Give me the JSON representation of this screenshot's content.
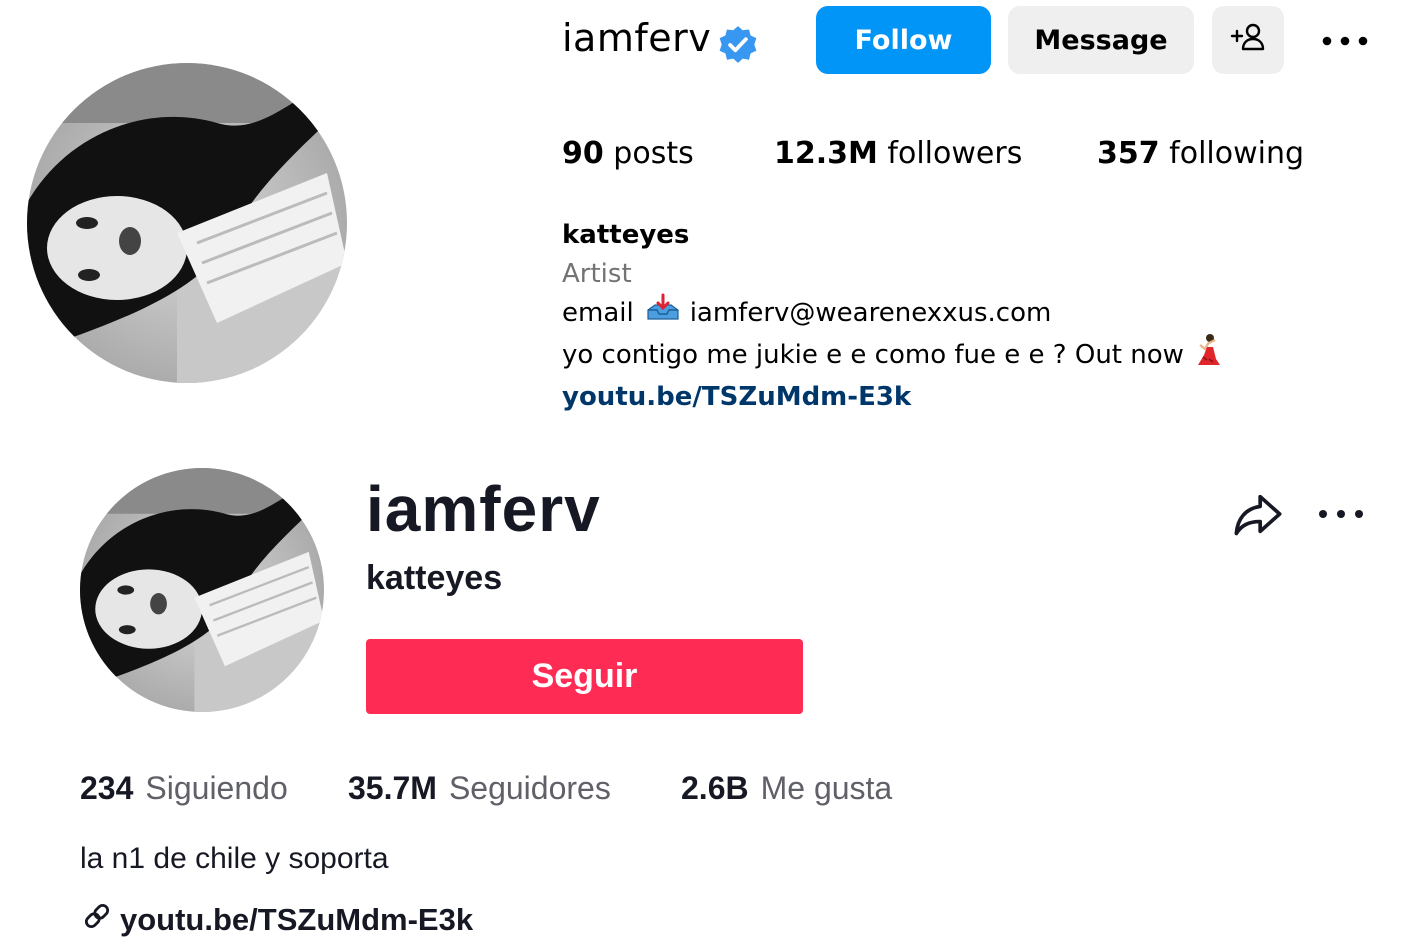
{
  "instagram": {
    "username": "iamferv",
    "verified_icon": "verified-badge-icon",
    "follow_label": "Follow",
    "message_label": "Message",
    "add_user_icon": "add-user-icon",
    "more_icon": "more-options-icon",
    "stats": [
      {
        "value": "90",
        "label": "posts"
      },
      {
        "value": "12.3M",
        "label": "followers"
      },
      {
        "value": "357",
        "label": "following"
      }
    ],
    "bio": {
      "name": "katteyes",
      "category": "Artist",
      "email_prefix": "email",
      "email_emoji": "inbox-tray-icon",
      "email": "iamferv@wearenexxus.com",
      "tagline": "yo contigo me jukie e e como fue e e ? Out now",
      "tagline_emoji": "dancer-icon",
      "link": "youtu.be/TSZuMdm-E3k"
    },
    "colors": {
      "follow": "#0095f6",
      "secondary": "#efefef",
      "link": "#00376b"
    }
  },
  "tiktok": {
    "username": "iamferv",
    "nickname": "katteyes",
    "follow_label": "Seguir",
    "share_icon": "share-icon",
    "more_icon": "more-options-icon",
    "stats": [
      {
        "value": "234",
        "label": "Siguiendo"
      },
      {
        "value": "35.7M",
        "label": "Seguidores"
      },
      {
        "value": "2.6B",
        "label": "Me gusta"
      }
    ],
    "bio": "la n1 de chile y soporta",
    "link_icon": "link-icon",
    "link": "youtu.be/TSZuMdm-E3k",
    "colors": {
      "follow": "#fe2c55",
      "text": "#161823"
    }
  }
}
